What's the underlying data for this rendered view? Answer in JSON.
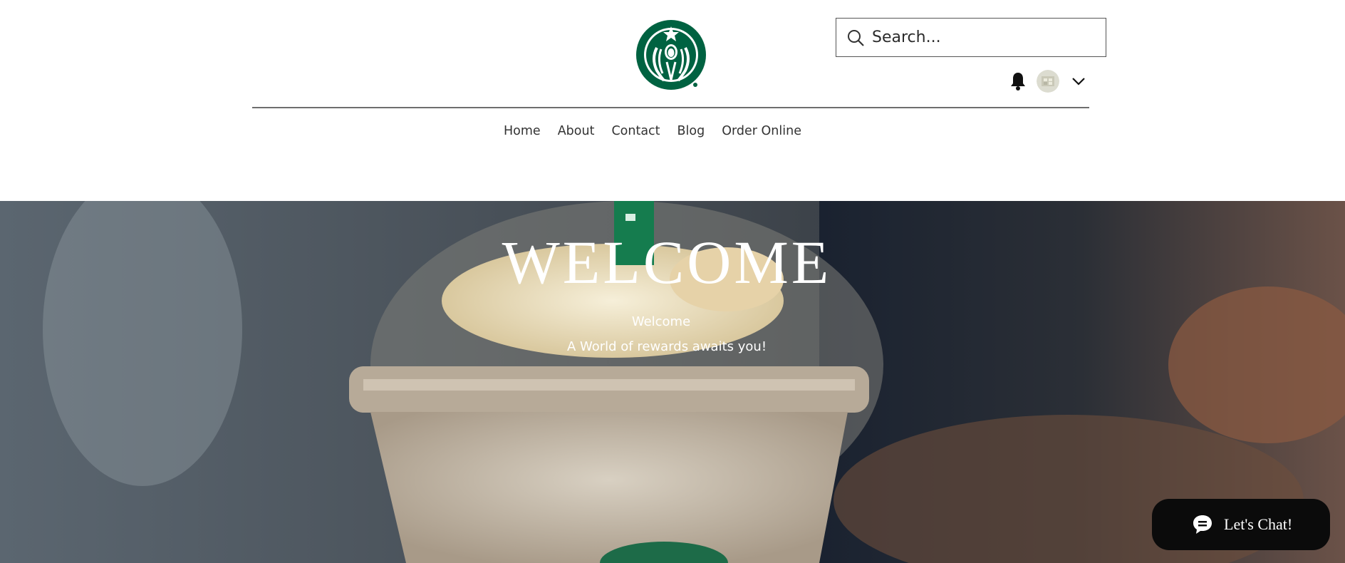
{
  "brand": {
    "logo_name": "starbucks-siren-logo",
    "accent_color": "#b13b91",
    "logo_green": "#006241"
  },
  "search": {
    "placeholder": "Search..."
  },
  "user": {
    "notifications_icon": "bell-icon",
    "avatar_icon": "avatar",
    "menu_icon": "chevron-down-icon"
  },
  "nav": {
    "items": [
      "Home",
      "About",
      "Contact",
      "Blog",
      "Order Online"
    ]
  },
  "hero": {
    "title": "WELCOME",
    "subtitle": "Welcome",
    "tagline": "A World of rewards awaits you!"
  },
  "chat": {
    "label": "Let's Chat!",
    "icon": "chat-bubble-icon"
  }
}
